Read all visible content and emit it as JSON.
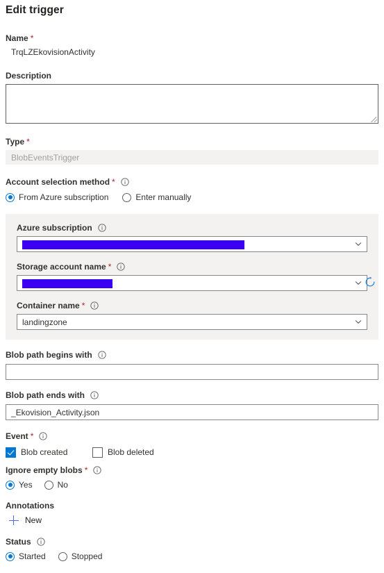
{
  "header": {
    "title": "Edit trigger"
  },
  "fields": {
    "name": {
      "label": "Name",
      "required": true,
      "value": "TrqLZEkovisionActivity"
    },
    "description": {
      "label": "Description",
      "required": false,
      "value": "",
      "placeholder": ""
    },
    "type": {
      "label": "Type",
      "required": true,
      "value": "BlobEventsTrigger",
      "disabled": true
    },
    "account_selection_method": {
      "label": "Account selection method",
      "required": true,
      "has_info": true,
      "options": [
        {
          "label": "From Azure subscription",
          "selected": true
        },
        {
          "label": "Enter manually",
          "selected": false
        }
      ]
    },
    "azure_subscription": {
      "label": "Azure subscription",
      "required": false,
      "has_info": true,
      "value": "",
      "redacted": true,
      "redact_width": 320
    },
    "storage_account_name": {
      "label": "Storage account name",
      "required": true,
      "has_info": true,
      "value": "",
      "redacted": true,
      "redact_width": 130
    },
    "container_name": {
      "label": "Container name",
      "required": true,
      "has_info": true,
      "value": "landingzone"
    },
    "blob_path_begins_with": {
      "label": "Blob path begins with",
      "required": false,
      "has_info": true,
      "value": ""
    },
    "blob_path_ends_with": {
      "label": "Blob path ends with",
      "required": false,
      "has_info": true,
      "value": "_Ekovision_Activity.json"
    },
    "event": {
      "label": "Event",
      "required": true,
      "has_info": true,
      "options": [
        {
          "label": "Blob created",
          "checked": true
        },
        {
          "label": "Blob deleted",
          "checked": false
        }
      ]
    },
    "ignore_empty_blobs": {
      "label": "Ignore empty blobs",
      "required": true,
      "has_info": true,
      "options": [
        {
          "label": "Yes",
          "selected": true
        },
        {
          "label": "No",
          "selected": false
        }
      ]
    },
    "annotations": {
      "label": "Annotations",
      "required": false,
      "new_label": "New"
    },
    "status": {
      "label": "Status",
      "required": false,
      "has_info": true,
      "options": [
        {
          "label": "Started",
          "selected": true
        },
        {
          "label": "Stopped",
          "selected": false
        }
      ]
    }
  },
  "icons": {
    "info": "info-icon",
    "refresh": "refresh-icon",
    "chevron_down": "chevron-down-icon",
    "plus": "plus-icon"
  },
  "colors": {
    "accent": "#0078d4",
    "required_asterisk": "#a4262c",
    "redaction": "#3a01f2",
    "panel_background": "#f3f2f1",
    "link": "#4f6bed"
  }
}
